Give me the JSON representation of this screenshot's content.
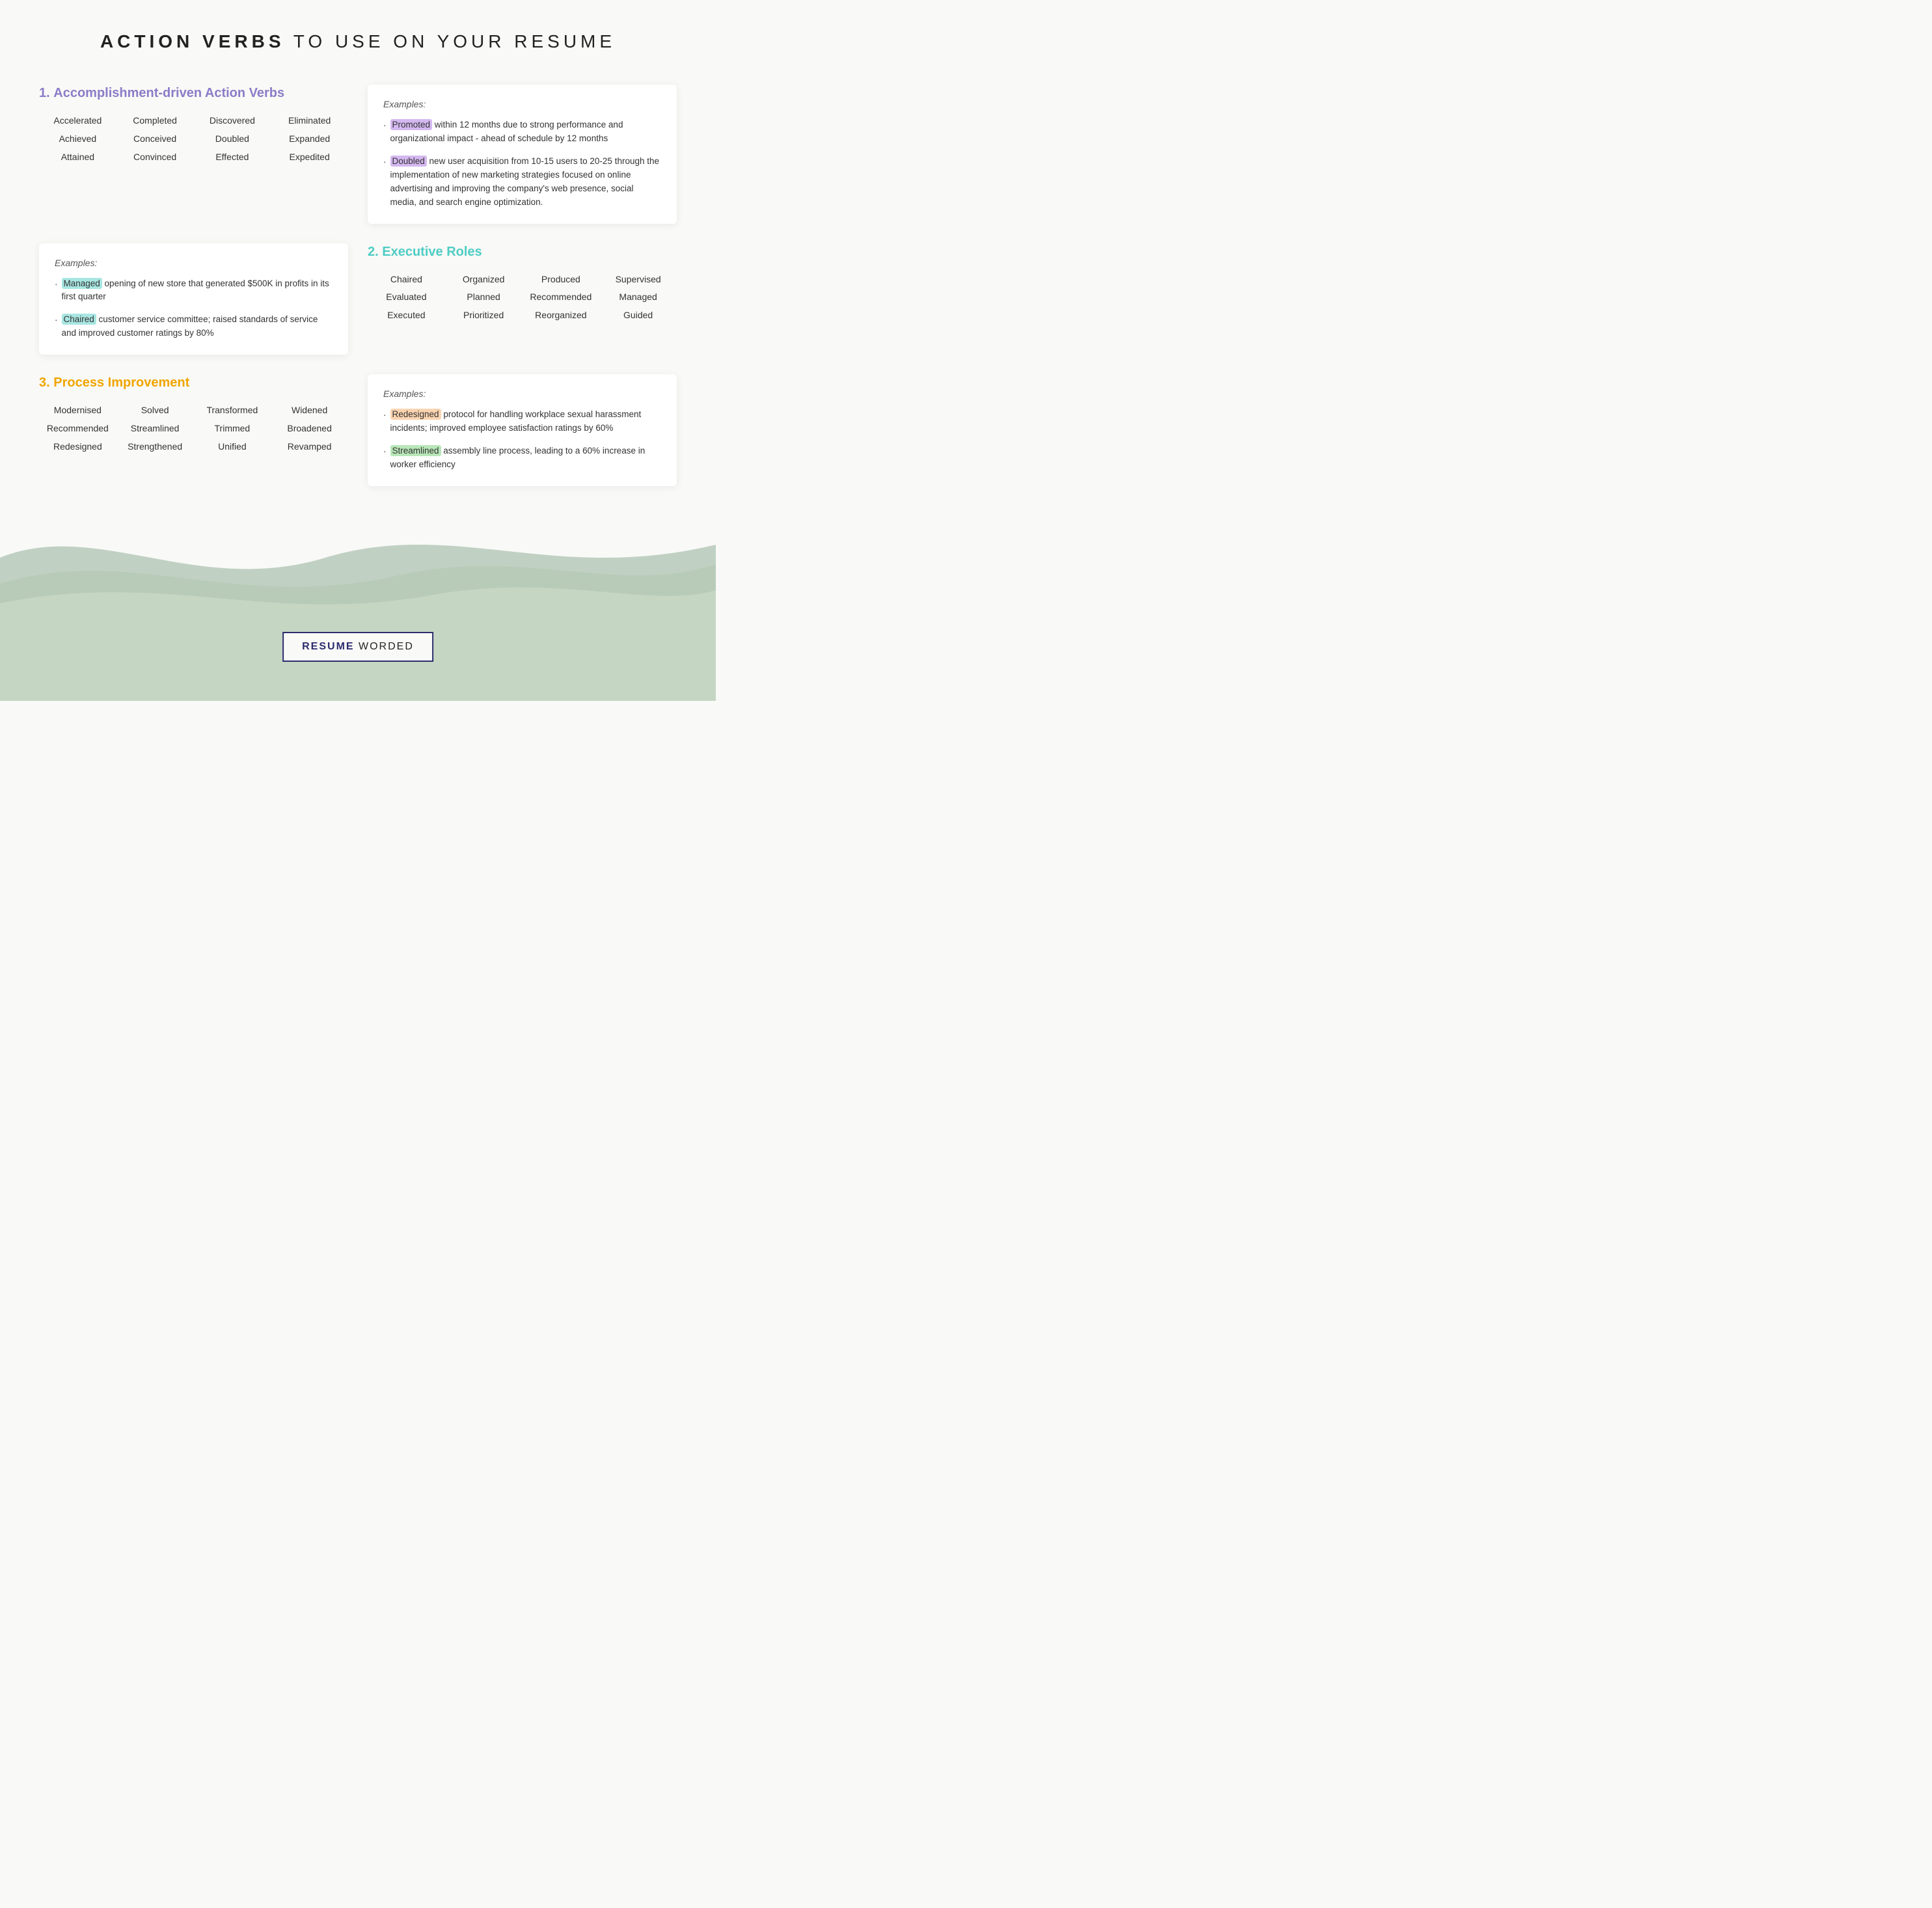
{
  "header": {
    "title_bold": "ACTION VERBS",
    "title_rest": " TO USE ON YOUR RESUME"
  },
  "section1": {
    "heading_num": "1.",
    "heading_text": "Accomplishment-driven Action Verbs",
    "words": {
      "col1": [
        "Accelerated",
        "Achieved",
        "Attained"
      ],
      "col2": [
        "Completed",
        "Conceived",
        "Convinced"
      ],
      "col3": [
        "Discovered",
        "Doubled",
        "Effected"
      ],
      "col4": [
        "Eliminated",
        "Expanded",
        "Expedited"
      ]
    },
    "examples_label": "Examples:",
    "examples": [
      {
        "highlight": "Promoted",
        "highlight_class": "highlight-purple",
        "rest": " within 12 months due to strong performance and organizational impact - ahead of schedule by 12 months"
      },
      {
        "highlight": "Doubled",
        "highlight_class": "highlight-purple",
        "rest": " new user acquisition from 10-15 users to 20-25 through the implementation of new marketing strategies focused on online advertising and improving the company's web presence, social media, and search engine optimization."
      }
    ]
  },
  "section1_left_examples": {
    "examples_label": "Examples:",
    "examples": [
      {
        "highlight": "Managed",
        "highlight_class": "highlight-teal",
        "rest": " opening of new store that generated $500K in profits in its first quarter"
      },
      {
        "highlight": "Chaired",
        "highlight_class": "highlight-teal",
        "rest": " customer service committee; raised standards of service and improved customer ratings by 80%"
      }
    ]
  },
  "section2": {
    "heading_num": "2.",
    "heading_text": "Executive Roles",
    "words": {
      "col1": [
        "Chaired",
        "Evaluated",
        "Executed"
      ],
      "col2": [
        "Organized",
        "Planned",
        "Prioritized"
      ],
      "col3": [
        "Produced",
        "Recommended",
        "Reorganized"
      ],
      "col4": [
        "Supervised",
        "Managed",
        "Guided"
      ]
    }
  },
  "section3": {
    "heading_num": "3.",
    "heading_text": "Process Improvement",
    "words": {
      "col1": [
        "Modernised",
        "Recommended",
        "Redesigned"
      ],
      "col2": [
        "Solved",
        "Streamlined",
        "Strengthened"
      ],
      "col3": [
        "Transformed",
        "Trimmed",
        "Unified"
      ],
      "col4": [
        "Widened",
        "Broadened",
        "Revamped"
      ]
    },
    "examples_label": "Examples:",
    "examples": [
      {
        "highlight": "Redesigned",
        "highlight_class": "highlight-orange",
        "rest": " protocol for handling workplace sexual harassment incidents; improved employee satisfaction ratings by 60%"
      },
      {
        "highlight": "Streamlined",
        "highlight_class": "highlight-green",
        "rest": " assembly line process, leading to a 60% increase in worker efficiency"
      }
    ]
  },
  "footer": {
    "logo_bold": "RESUME",
    "logo_rest": " WORDED"
  },
  "colors": {
    "purple": "#8b7cc8",
    "teal": "#4ecdc4",
    "orange": "#f0a500"
  }
}
